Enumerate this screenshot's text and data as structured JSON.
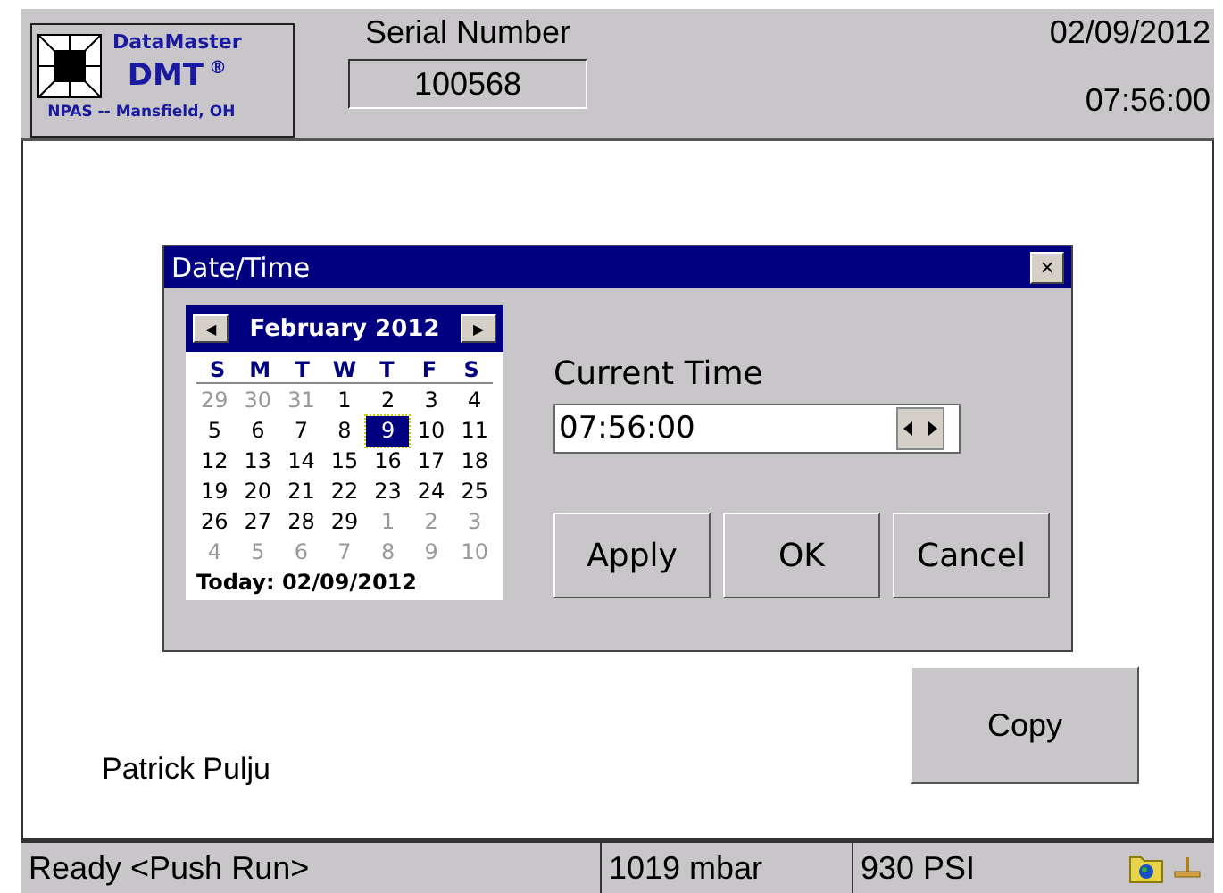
{
  "header": {
    "logo": {
      "brand": "DataMaster",
      "product": "DMT",
      "mark": "®",
      "location": "NPAS -- Mansfield, OH"
    },
    "serial_label": "Serial Number",
    "serial_value": "100568",
    "date": "02/09/2012",
    "time": "07:56:00"
  },
  "dialog": {
    "title": "Date/Time",
    "close": "×",
    "calendar": {
      "prev": "◀",
      "next": "▶",
      "month": "February 2012",
      "weekdays": [
        "S",
        "M",
        "T",
        "W",
        "T",
        "F",
        "S"
      ],
      "weeks": [
        [
          {
            "day": "29",
            "in_month": false,
            "selected": false
          },
          {
            "day": "30",
            "in_month": false,
            "selected": false
          },
          {
            "day": "31",
            "in_month": false,
            "selected": false
          },
          {
            "day": "1",
            "in_month": true,
            "selected": false
          },
          {
            "day": "2",
            "in_month": true,
            "selected": false
          },
          {
            "day": "3",
            "in_month": true,
            "selected": false
          },
          {
            "day": "4",
            "in_month": true,
            "selected": false
          }
        ],
        [
          {
            "day": "5",
            "in_month": true,
            "selected": false
          },
          {
            "day": "6",
            "in_month": true,
            "selected": false
          },
          {
            "day": "7",
            "in_month": true,
            "selected": false
          },
          {
            "day": "8",
            "in_month": true,
            "selected": false
          },
          {
            "day": "9",
            "in_month": true,
            "selected": true
          },
          {
            "day": "10",
            "in_month": true,
            "selected": false
          },
          {
            "day": "11",
            "in_month": true,
            "selected": false
          }
        ],
        [
          {
            "day": "12",
            "in_month": true,
            "selected": false
          },
          {
            "day": "13",
            "in_month": true,
            "selected": false
          },
          {
            "day": "14",
            "in_month": true,
            "selected": false
          },
          {
            "day": "15",
            "in_month": true,
            "selected": false
          },
          {
            "day": "16",
            "in_month": true,
            "selected": false
          },
          {
            "day": "17",
            "in_month": true,
            "selected": false
          },
          {
            "day": "18",
            "in_month": true,
            "selected": false
          }
        ],
        [
          {
            "day": "19",
            "in_month": true,
            "selected": false
          },
          {
            "day": "20",
            "in_month": true,
            "selected": false
          },
          {
            "day": "21",
            "in_month": true,
            "selected": false
          },
          {
            "day": "22",
            "in_month": true,
            "selected": false
          },
          {
            "day": "23",
            "in_month": true,
            "selected": false
          },
          {
            "day": "24",
            "in_month": true,
            "selected": false
          },
          {
            "day": "25",
            "in_month": true,
            "selected": false
          }
        ],
        [
          {
            "day": "26",
            "in_month": true,
            "selected": false
          },
          {
            "day": "27",
            "in_month": true,
            "selected": false
          },
          {
            "day": "28",
            "in_month": true,
            "selected": false
          },
          {
            "day": "29",
            "in_month": true,
            "selected": false
          },
          {
            "day": "1",
            "in_month": false,
            "selected": false
          },
          {
            "day": "2",
            "in_month": false,
            "selected": false
          },
          {
            "day": "3",
            "in_month": false,
            "selected": false
          }
        ],
        [
          {
            "day": "4",
            "in_month": false,
            "selected": false
          },
          {
            "day": "5",
            "in_month": false,
            "selected": false
          },
          {
            "day": "6",
            "in_month": false,
            "selected": false
          },
          {
            "day": "7",
            "in_month": false,
            "selected": false
          },
          {
            "day": "8",
            "in_month": false,
            "selected": false
          },
          {
            "day": "9",
            "in_month": false,
            "selected": false
          },
          {
            "day": "10",
            "in_month": false,
            "selected": false
          }
        ]
      ],
      "today": "Today: 02/09/2012"
    },
    "time_label": "Current Time",
    "time_value": "07:56:00",
    "buttons": [
      "Apply",
      "OK",
      "Cancel"
    ]
  },
  "copy_button": "Copy",
  "operator": "Patrick Pulju",
  "status_bar": {
    "message": "Ready <Push Run>",
    "pressure": "1019 mbar",
    "tank": "930 PSI"
  }
}
